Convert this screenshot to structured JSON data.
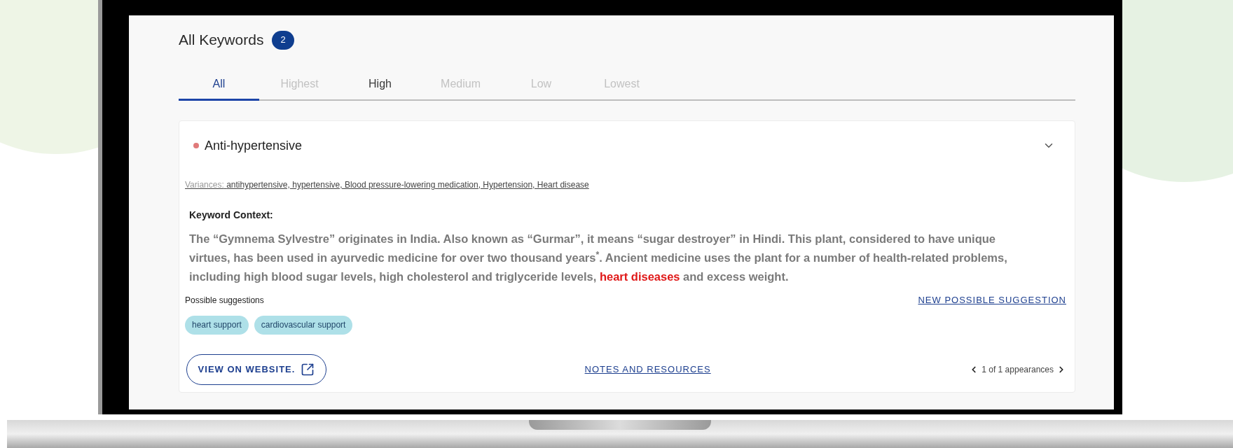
{
  "header": {
    "title": "All Keywords",
    "count": "2"
  },
  "tabs": [
    {
      "label": "All",
      "selected": true,
      "muted": false
    },
    {
      "label": "Highest",
      "selected": false,
      "muted": true
    },
    {
      "label": "High",
      "selected": false,
      "muted": false
    },
    {
      "label": "Medium",
      "selected": false,
      "muted": true
    },
    {
      "label": "Low",
      "selected": false,
      "muted": true
    },
    {
      "label": "Lowest",
      "selected": false,
      "muted": true
    }
  ],
  "keyword_card": {
    "title": "Anti-hypertensive",
    "color": "#e07a7a",
    "expanded": true,
    "variances_label": "Variances:",
    "variances": "antihypertensive, hypertensive, Blood pressure-lowering medication, Hypertension, Heart disease",
    "context_heading": "Keyword Context:",
    "context": [
      {
        "text": "The “Gymnema Sylvestre” originates in India. Also known as “Gurmar”, it means “sugar destroyer” in Hindi. This plant, considered to have unique virtues, has been used in ayurvedic medicine for over two thousand years$^{*}$. Ancient medicine uses the plant for a number of health-related problems, including high blood sugar levels, high cholesterol and triglyceride levels, ",
        "highlight": false
      },
      {
        "text": "heart diseases",
        "highlight": true
      },
      {
        "text": " and excess weight.",
        "highlight": false
      }
    ],
    "suggestions_label": "Possible suggestions",
    "new_suggestion_link": "NEW POSSIBLE SUGGESTION",
    "suggestions": [
      "heart support",
      "cardiovascular support"
    ],
    "view_button": "VIEW ON WEBSITE.",
    "notes_link": "NOTES AND RESOURCES",
    "pagination": "1 of 1 appearances"
  }
}
